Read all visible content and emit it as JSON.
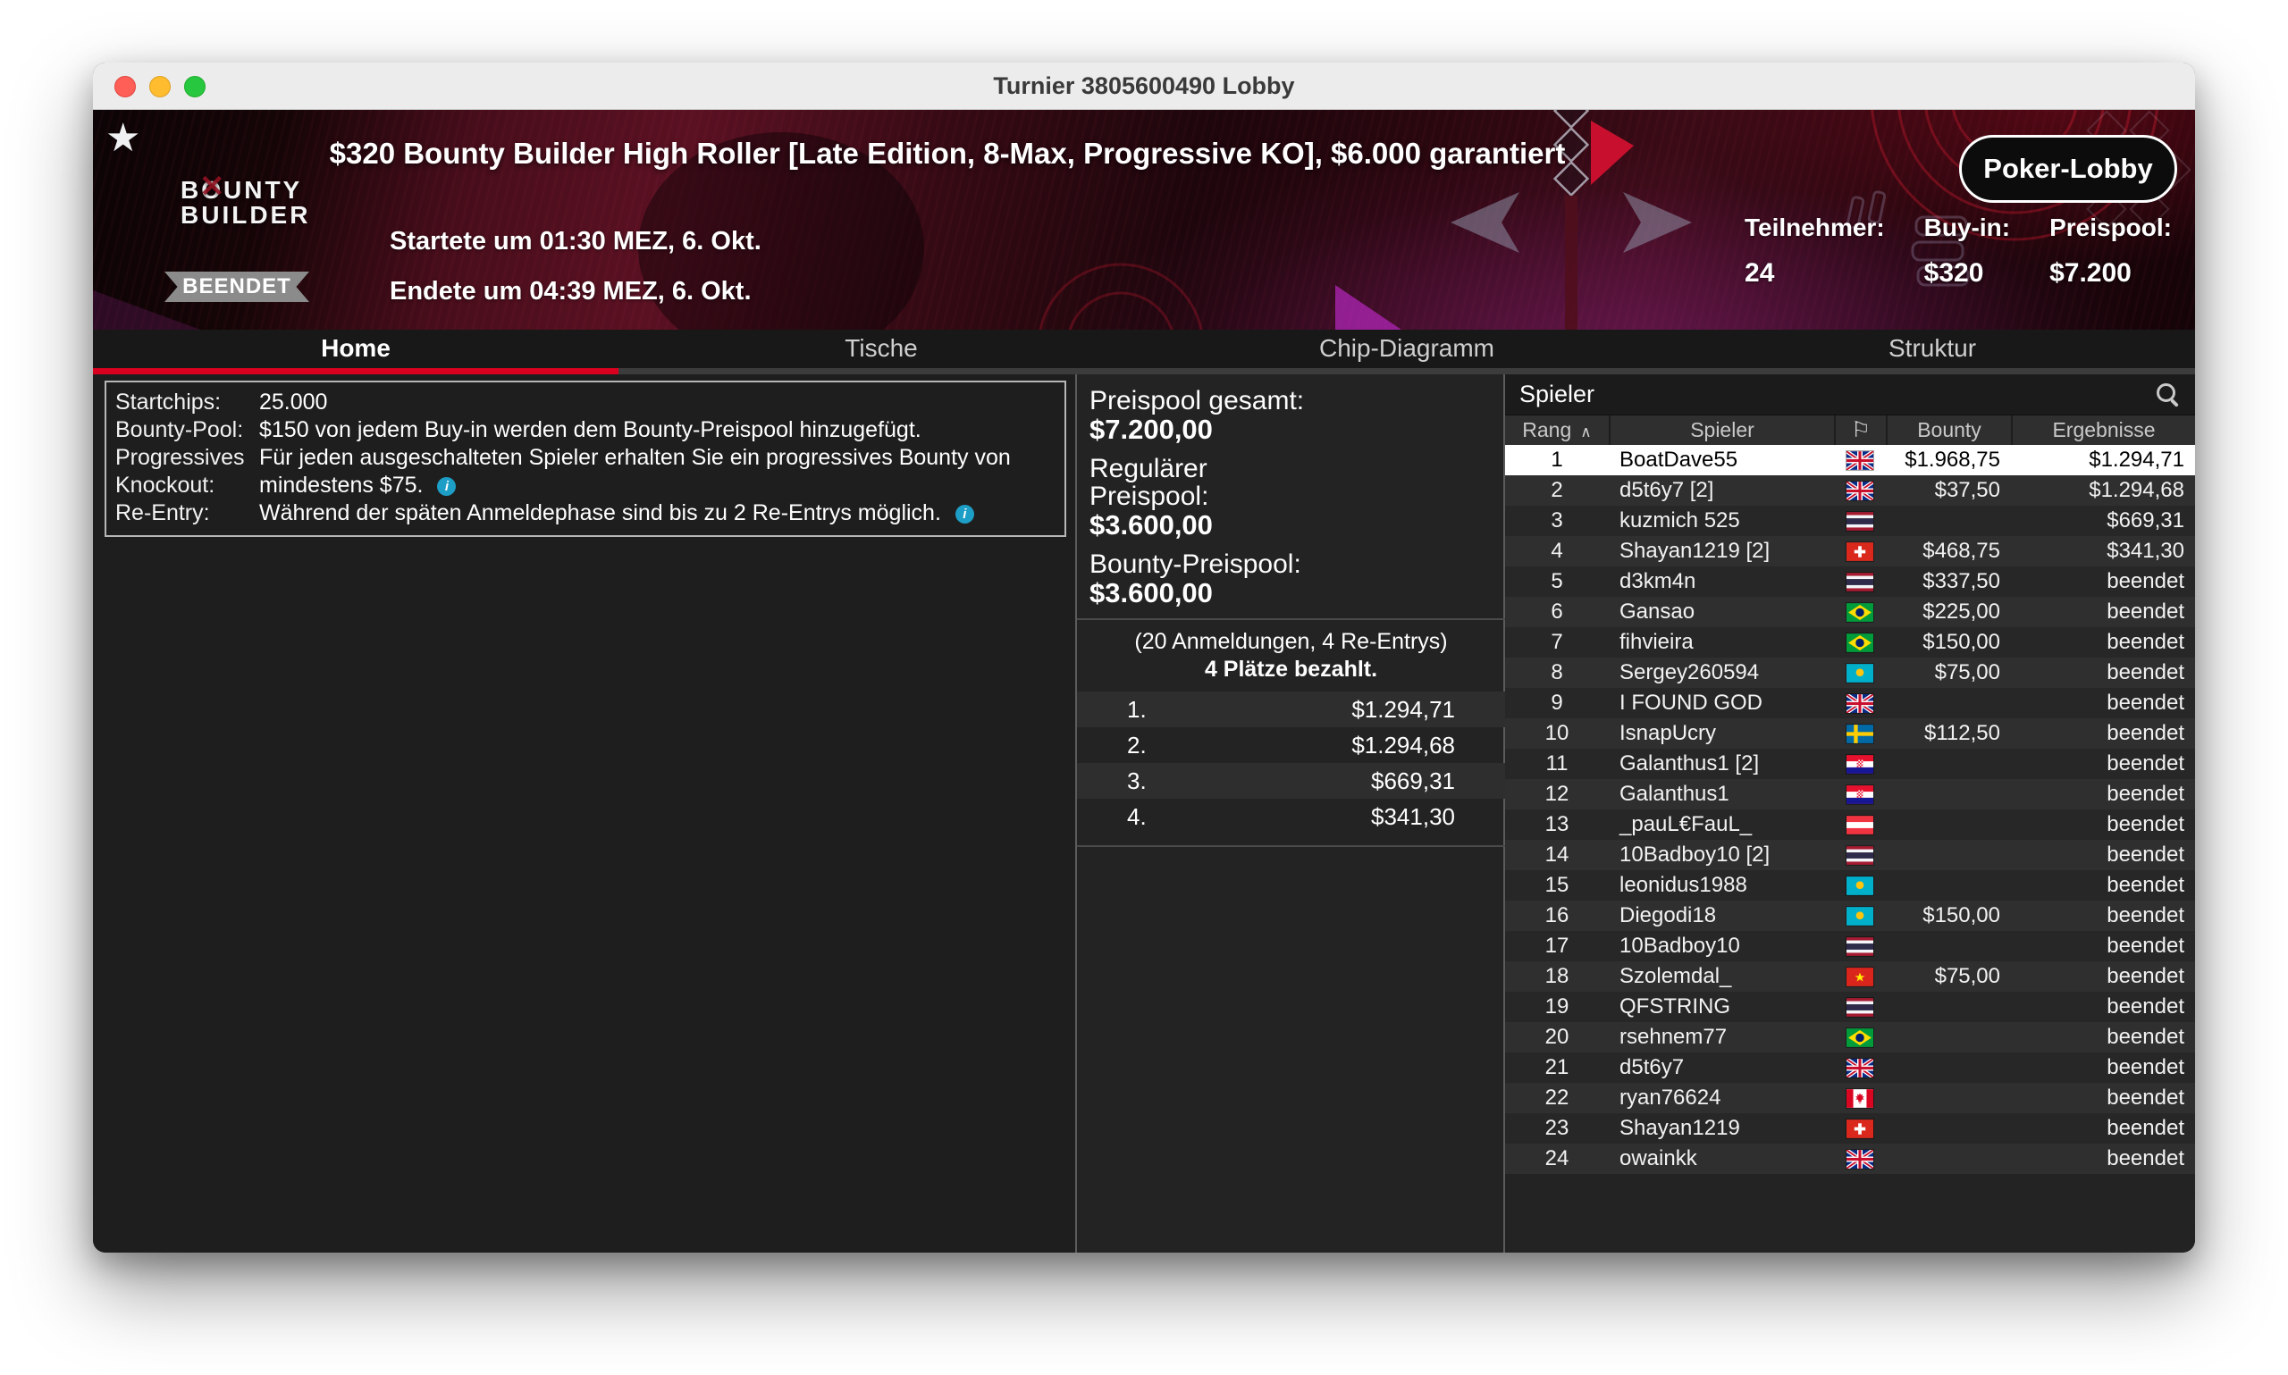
{
  "window": {
    "title": "Turnier 3805600490 Lobby"
  },
  "icons": {
    "favorite": "★",
    "logo_mark": "✕",
    "info": "i",
    "sort_asc": "∧",
    "flag_header": "⚐"
  },
  "colors": {
    "accent_red": "#d8001e",
    "info_blue": "#1d9ec6",
    "badge_gray": "#8b8b8b",
    "selected_row": "#ffffff"
  },
  "banner": {
    "title": "$320 Bounty Builder High Roller [Late Edition, 8-Max, Progressive KO], $6.000 garantiert",
    "logo": {
      "line1": "BOUNTY",
      "line2": "BUILDER"
    },
    "status": "BEENDET",
    "started": "Startete um 01:30 MEZ, 6. Okt.",
    "ended": "Endete um 04:39 MEZ, 6. Okt.",
    "stats": [
      {
        "label": "Teilnehmer:",
        "value": "24"
      },
      {
        "label": "Buy-in:",
        "value": "$320"
      },
      {
        "label": "Preispool:",
        "value": "$7.200"
      }
    ],
    "lobby_button": "Poker-Lobby"
  },
  "tabs": [
    {
      "label": "Home",
      "active": true
    },
    {
      "label": "Tische",
      "active": false
    },
    {
      "label": "Chip-Diagramm",
      "active": false
    },
    {
      "label": "Struktur",
      "active": false
    }
  ],
  "info_panel": {
    "rows": [
      {
        "label": "Startchips:",
        "value": "25.000",
        "info": false
      },
      {
        "label": "Bounty-Pool:",
        "value": "$150 von jedem Buy-in werden dem Bounty-Preispool hinzugefügt.",
        "info": false
      },
      {
        "label": "Progressives Knockout:",
        "value": "Für jeden ausgeschalteten Spieler erhalten Sie ein progressives Bounty von mindestens $75.",
        "info": true
      },
      {
        "label": "Re-Entry:",
        "value": "Während der späten Anmeldephase sind bis zu 2 Re-Entrys möglich.",
        "info": true
      }
    ]
  },
  "prize": {
    "total_label": "Preispool gesamt:",
    "total_value": "$7.200,00",
    "regular_label": "Regulärer\nPreispool:",
    "regular_value": "$3.600,00",
    "bounty_label": "Bounty-Preispool:",
    "bounty_value": "$3.600,00",
    "entries_note": "(20 Anmeldungen, 4 Re-Entrys)",
    "paid_note": "4 Plätze bezahlt.",
    "payouts": [
      {
        "place": "1.",
        "amount": "$1.294,71"
      },
      {
        "place": "2.",
        "amount": "$1.294,68"
      },
      {
        "place": "3.",
        "amount": "$669,31"
      },
      {
        "place": "4.",
        "amount": "$341,30"
      }
    ]
  },
  "players": {
    "title": "Spieler",
    "columns": {
      "rank": "Rang",
      "player": "Spieler",
      "bounty": "Bounty",
      "results": "Ergebnisse"
    },
    "list": [
      {
        "rank": 1,
        "name": "BoatDave55",
        "country": "gb",
        "bounty": "$1.968,75",
        "result": "$1.294,71",
        "selected": true
      },
      {
        "rank": 2,
        "name": "d5t6y7 [2]",
        "country": "gb",
        "bounty": "$37,50",
        "result": "$1.294,68"
      },
      {
        "rank": 3,
        "name": "kuzmich 525",
        "country": "th",
        "bounty": "",
        "result": "$669,31"
      },
      {
        "rank": 4,
        "name": "Shayan1219 [2]",
        "country": "ch",
        "bounty": "$468,75",
        "result": "$341,30"
      },
      {
        "rank": 5,
        "name": "d3km4n",
        "country": "th",
        "bounty": "$337,50",
        "result": "beendet"
      },
      {
        "rank": 6,
        "name": "Gansao",
        "country": "br",
        "bounty": "$225,00",
        "result": "beendet"
      },
      {
        "rank": 7,
        "name": "fihvieira",
        "country": "br",
        "bounty": "$150,00",
        "result": "beendet"
      },
      {
        "rank": 8,
        "name": "Sergey260594",
        "country": "kz",
        "bounty": "$75,00",
        "result": "beendet"
      },
      {
        "rank": 9,
        "name": "I FOUND GOD",
        "country": "gb",
        "bounty": "",
        "result": "beendet"
      },
      {
        "rank": 10,
        "name": "IsnapUcry",
        "country": "se",
        "bounty": "$112,50",
        "result": "beendet"
      },
      {
        "rank": 11,
        "name": "Galanthus1 [2]",
        "country": "hr",
        "bounty": "",
        "result": "beendet"
      },
      {
        "rank": 12,
        "name": "Galanthus1",
        "country": "hr",
        "bounty": "",
        "result": "beendet"
      },
      {
        "rank": 13,
        "name": "_pauL€FauL_",
        "country": "at",
        "bounty": "",
        "result": "beendet"
      },
      {
        "rank": 14,
        "name": "10Badboy10 [2]",
        "country": "th",
        "bounty": "",
        "result": "beendet"
      },
      {
        "rank": 15,
        "name": "leonidus1988",
        "country": "kz",
        "bounty": "",
        "result": "beendet"
      },
      {
        "rank": 16,
        "name": "Diegodi18",
        "country": "kz",
        "bounty": "$150,00",
        "result": "beendet"
      },
      {
        "rank": 17,
        "name": "10Badboy10",
        "country": "th",
        "bounty": "",
        "result": "beendet"
      },
      {
        "rank": 18,
        "name": "Szolemdal_",
        "country": "vn",
        "bounty": "$75,00",
        "result": "beendet"
      },
      {
        "rank": 19,
        "name": "QFSTRING",
        "country": "th",
        "bounty": "",
        "result": "beendet"
      },
      {
        "rank": 20,
        "name": "rsehnem77",
        "country": "br",
        "bounty": "",
        "result": "beendet"
      },
      {
        "rank": 21,
        "name": "d5t6y7",
        "country": "gb",
        "bounty": "",
        "result": "beendet"
      },
      {
        "rank": 22,
        "name": "ryan76624",
        "country": "ca",
        "bounty": "",
        "result": "beendet"
      },
      {
        "rank": 23,
        "name": "Shayan1219",
        "country": "ch",
        "bounty": "",
        "result": "beendet"
      },
      {
        "rank": 24,
        "name": "owainkk",
        "country": "gb",
        "bounty": "",
        "result": "beendet"
      }
    ]
  }
}
